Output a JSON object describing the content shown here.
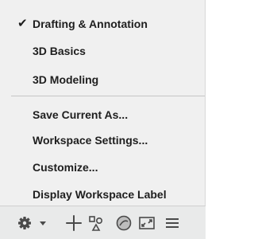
{
  "workspace_menu": {
    "items": [
      {
        "label": "Drafting & Annotation",
        "checked": true
      },
      {
        "label": "3D Basics",
        "checked": false
      },
      {
        "label": "3D Modeling",
        "checked": false
      },
      {
        "label": "Save Current As...",
        "checked": false
      },
      {
        "label": "Workspace Settings...",
        "checked": false
      },
      {
        "label": "Customize...",
        "checked": false
      },
      {
        "label": "Display Workspace Label",
        "checked": false
      }
    ],
    "check_glyph": "✔"
  },
  "status_bar": {
    "icons": [
      "gear-icon",
      "chevron-down-icon",
      "crosshair-icon",
      "isolate-objects-icon",
      "hardware-acceleration-icon",
      "clean-screen-icon",
      "customization-menu-icon"
    ],
    "icon_color": "#4a4a4a"
  }
}
